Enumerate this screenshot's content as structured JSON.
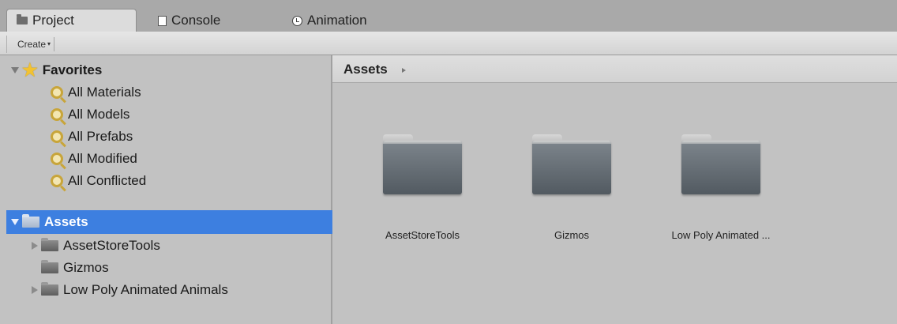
{
  "tabs": [
    {
      "label": "Project",
      "icon": "folder-icon"
    },
    {
      "label": "Console",
      "icon": "console-icon"
    },
    {
      "label": "Animation",
      "icon": "clock-icon"
    }
  ],
  "toolbar": {
    "create_label": "Create",
    "create_caret": "▾"
  },
  "favorites": {
    "label": "Favorites",
    "items": [
      "All Materials",
      "All Models",
      "All Prefabs",
      "All Modified",
      "All Conflicted"
    ]
  },
  "tree": {
    "root_label": "Assets",
    "children": [
      {
        "label": "AssetStoreTools",
        "expandable": true
      },
      {
        "label": "Gizmos",
        "expandable": false
      },
      {
        "label": "Low Poly Animated Animals",
        "expandable": true
      }
    ]
  },
  "breadcrumb": {
    "label": "Assets"
  },
  "grid_items": [
    "AssetStoreTools",
    "Gizmos",
    "Low Poly Animated ..."
  ],
  "colors": {
    "selection": "#3d7fe0",
    "panel": "#c2c2c2"
  }
}
